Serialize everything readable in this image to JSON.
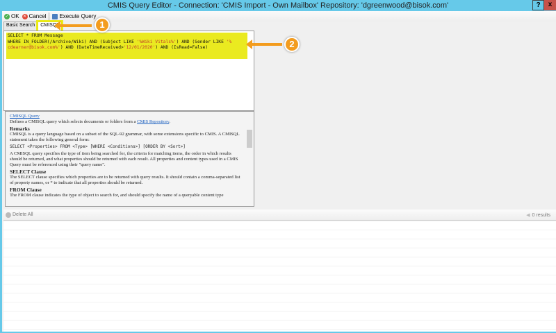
{
  "window": {
    "title": "CMIS Query Editor - Connection: 'CMIS Import - Own Mailbox' Repository: 'dgreenwood@bisok.com'",
    "help": "?",
    "close": "x"
  },
  "toolbar": {
    "ok": "OK",
    "cancel": "Cancel",
    "execute": "Execute Query"
  },
  "tabs": [
    "Basic Search",
    "CMISQL"
  ],
  "query": {
    "line1": "SELECT * FROM Message",
    "line2a": "WHERE IN_FOLDER(/Archive/Wiki) AND (Subject LIKE ",
    "s1": "'%Wiki Vitals%'",
    "line2b": ") AND (Sender LIKE ",
    "s2a": "'%",
    "s2b": "cdearner@bisok.com%'",
    "line3a": ") AND (DateTimeReceived>",
    "s3": "'12/01/2020'",
    "line3b": ") AND (IsRead=False)"
  },
  "help": {
    "title": "CMISQL Query",
    "intro": "Defines a CMISQL query which selects documents or folders from a ",
    "intro_link": "CMIS Repository",
    "intro_end": ".",
    "remarks_h": "Remarks",
    "remarks": "CMISQL is a query language based on a subset of the SQL-92 grammar, with some extensions specific to CMIS. A CMISQL statement takes the following general form:",
    "form": "SELECT <Properties> FROM <Type> [WHERE <Conditions>] [ORDER BY <Sort>]",
    "para2": "A CMISQL query specifies the type of item being searched for, the criteria for matching items, the order in which results should be returned, and what properties should be returned with each result. All properties and content types used in a CMIS Query must be referenced using their \"query name\".",
    "select_h": "SELECT Clause",
    "select": "The SELECT clause specifies which properties are to be returned with query results. It should contain a comma-separated list of property names, or * to indicate that all properties should be returned.",
    "from_h": "FROM Clause",
    "from": "The FROM clause indicates the type of object to search for, and should specify the name of a queryable content type"
  },
  "bottom": {
    "delete_all": "Delete All",
    "results": "0 results"
  },
  "callouts": [
    "1",
    "2"
  ]
}
